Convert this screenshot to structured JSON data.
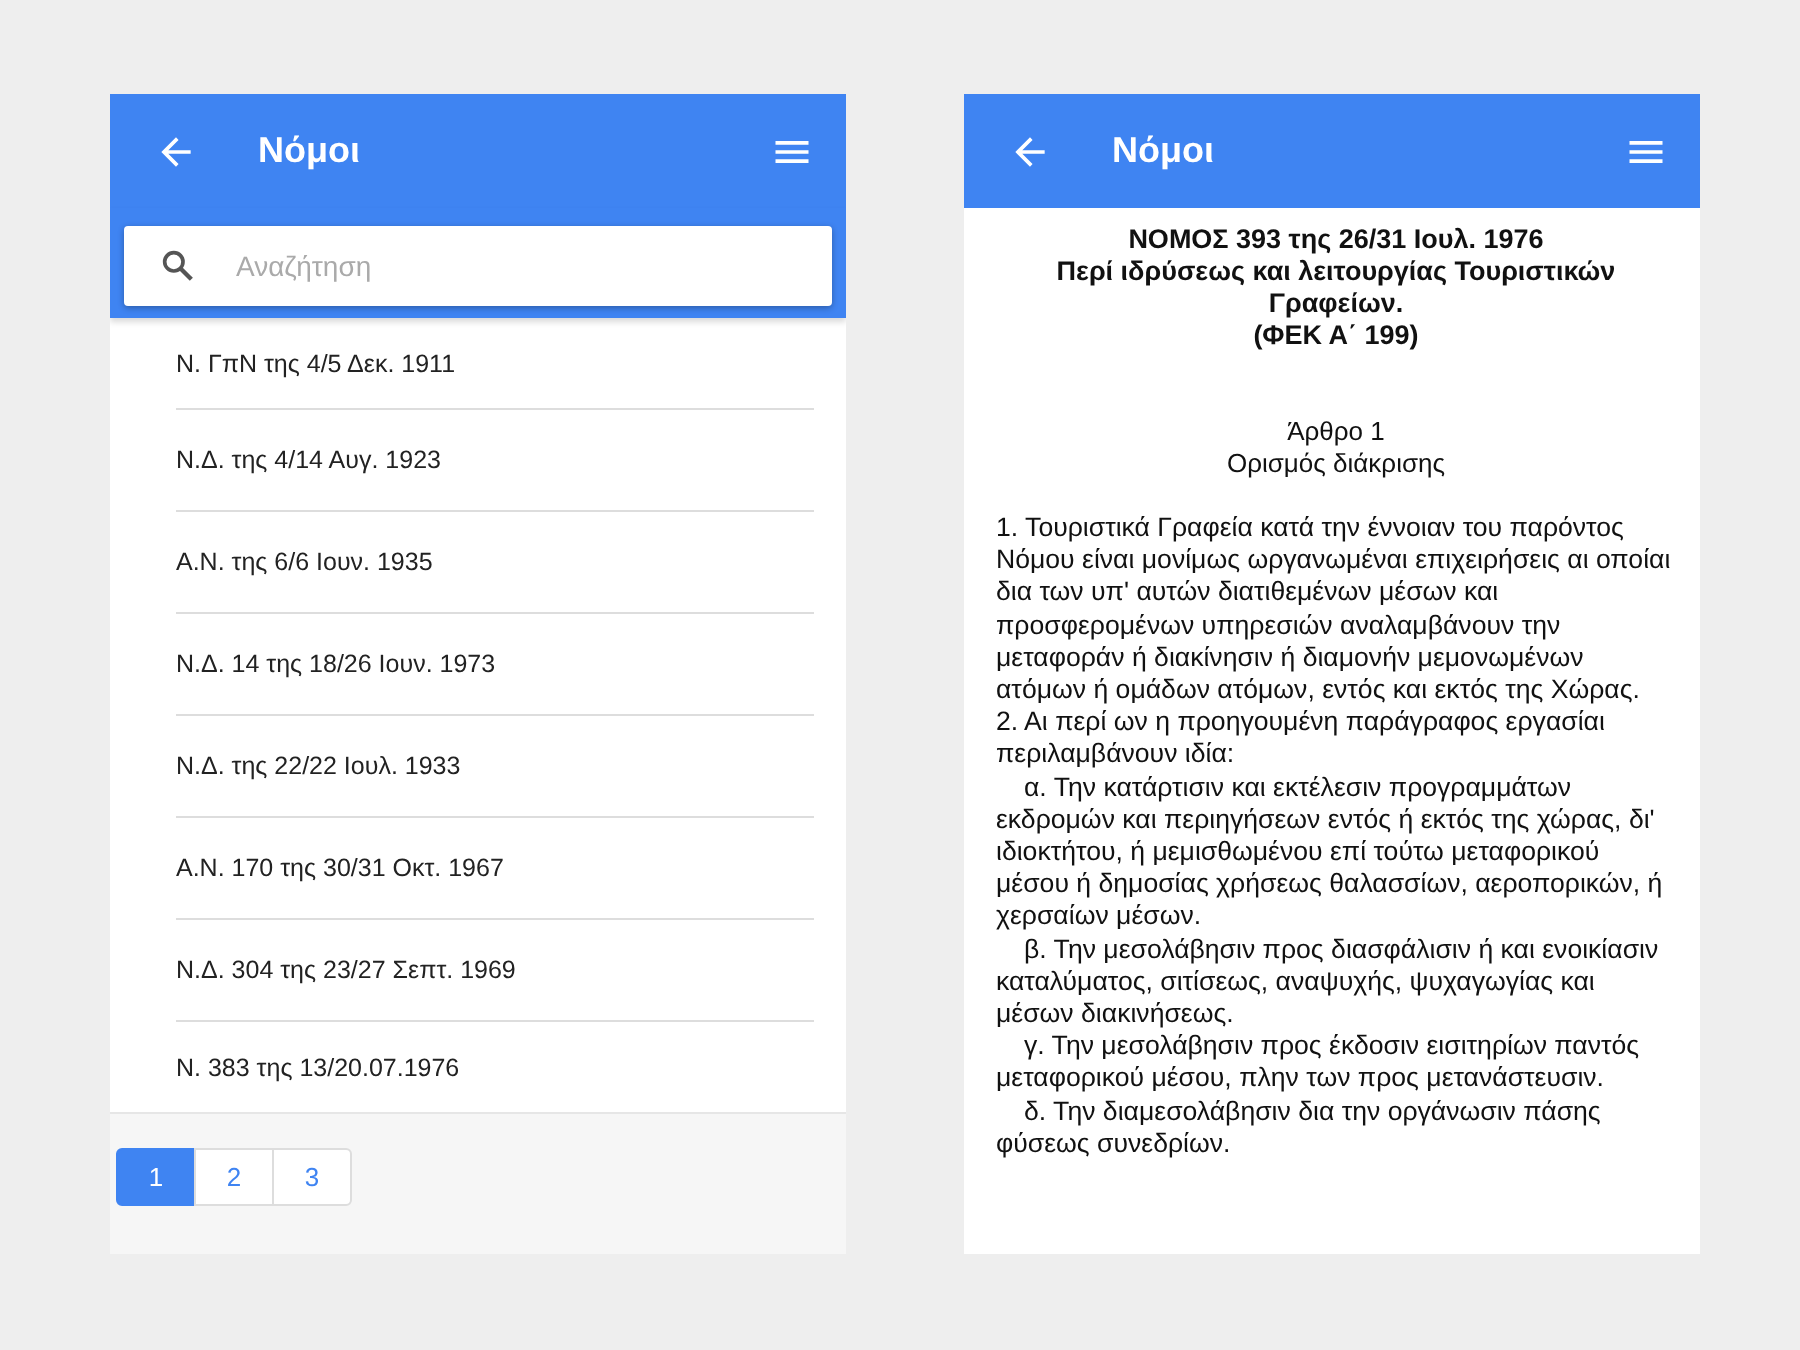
{
  "list_screen": {
    "title": "Νόμοι",
    "search": {
      "placeholder": "Αναζήτηση"
    },
    "items": [
      "Ν. ΓπΝ της 4/5 Δεκ. 1911",
      "Ν.Δ. της 4/14 Αυγ. 1923",
      "Α.Ν. της 6/6 Ιουν. 1935",
      "Ν.Δ. 14 της 18/26 Ιουν. 1973",
      "Ν.Δ. της 22/22 Ιουλ. 1933",
      "Α.Ν. 170 της 30/31 Οκτ. 1967",
      "Ν.Δ. 304 της 23/27 Σεπτ. 1969",
      "Ν. 383 της 13/20.07.1976"
    ],
    "pages": [
      {
        "label": "1",
        "selected": true
      },
      {
        "label": "2",
        "selected": false
      },
      {
        "label": "3",
        "selected": false
      }
    ]
  },
  "detail_screen": {
    "title": "Νόμοι",
    "law_title": [
      "ΝΟΜΟΣ 393 της 26/31 Ιουλ. 1976",
      "Περί ιδρύσεως και λειτουργίας Τουριστικών Γραφείων.",
      "(ΦΕΚ Α΄ 199)"
    ],
    "article": [
      "Άρθρο 1",
      "Ορισμός διάκρισης"
    ],
    "paragraphs": [
      {
        "kind": "numbered",
        "text": "1. Τουριστικά Γραφεία κατά την έννοιαν του παρόντος Νόμου είναι μονίμως ωργανωμέναι επιχειρήσεις αι οποίαι δια των υπ' αυτών διατιθεμένων μέσων και προσφερομένων υπηρεσιών αναλαμβάνουν την μεταφοράν ή διακίνησιν ή διαμονήν μεμονωμένων ατόμων ή ομάδων ατόμων, εντός και εκτός της Χώρας."
      },
      {
        "kind": "numbered",
        "text": "2. Αι περί ων η προηγουμένη παράγραφος εργασίαι περιλαμβάνουν ιδία:"
      },
      {
        "kind": "sub",
        "text": "α. Την κατάρτισιν και εκτέλεσιν προγραμμάτων εκδρομών και περιηγήσεων εντός ή εκτός της χώρας, δι' ιδιοκτήτου, ή μεμισθωμένου επί τούτω μεταφορικού μέσου ή δημοσίας χρήσεως θαλασσίων, αεροπορικών, ή χερσαίων μέσων."
      },
      {
        "kind": "sub",
        "text": "β. Την μεσολάβησιν προς διασφάλισιν ή και ενοικίασιν καταλύματος, σιτίσεως, αναψυχής, ψυχαγωγίας και μέσων διακινήσεως."
      },
      {
        "kind": "sub",
        "text": "γ. Την μεσολάβησιν προς έκδοσιν εισιτηρίων παντός μεταφορικού μέσου, πλην των προς μετανάστευσιν."
      },
      {
        "kind": "sub",
        "text": "δ. Την διαμεσολάβησιν δια την οργάνωσιν πάσης φύσεως συνεδρίων."
      }
    ]
  }
}
